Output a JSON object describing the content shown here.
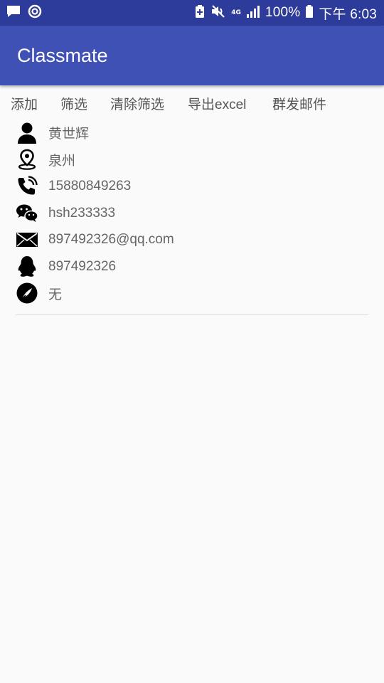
{
  "status_bar": {
    "network": "4G",
    "battery": "100%",
    "time": "下午 6:03"
  },
  "app_bar": {
    "title": "Classmate"
  },
  "toolbar": {
    "add": "添加",
    "filter": "筛选",
    "clear_filter": "清除筛选",
    "export_excel": "导出excel",
    "mass_email": "群发邮件"
  },
  "contact": {
    "name": "黄世辉",
    "city": "泉州",
    "phone": "15880849263",
    "wechat": "hsh233333",
    "email": "897492326@qq.com",
    "qq": "897492326",
    "note": "无"
  },
  "icons": {
    "name": "person-icon",
    "city": "location-pin-icon",
    "phone": "phone-icon",
    "wechat": "wechat-icon",
    "email": "envelope-icon",
    "qq": "qq-penguin-icon",
    "note": "feather-icon"
  },
  "colors": {
    "status_bar": "#2d3b9a",
    "app_bar": "#3f51b5",
    "background": "#fafafa",
    "text_secondary": "#666666"
  }
}
